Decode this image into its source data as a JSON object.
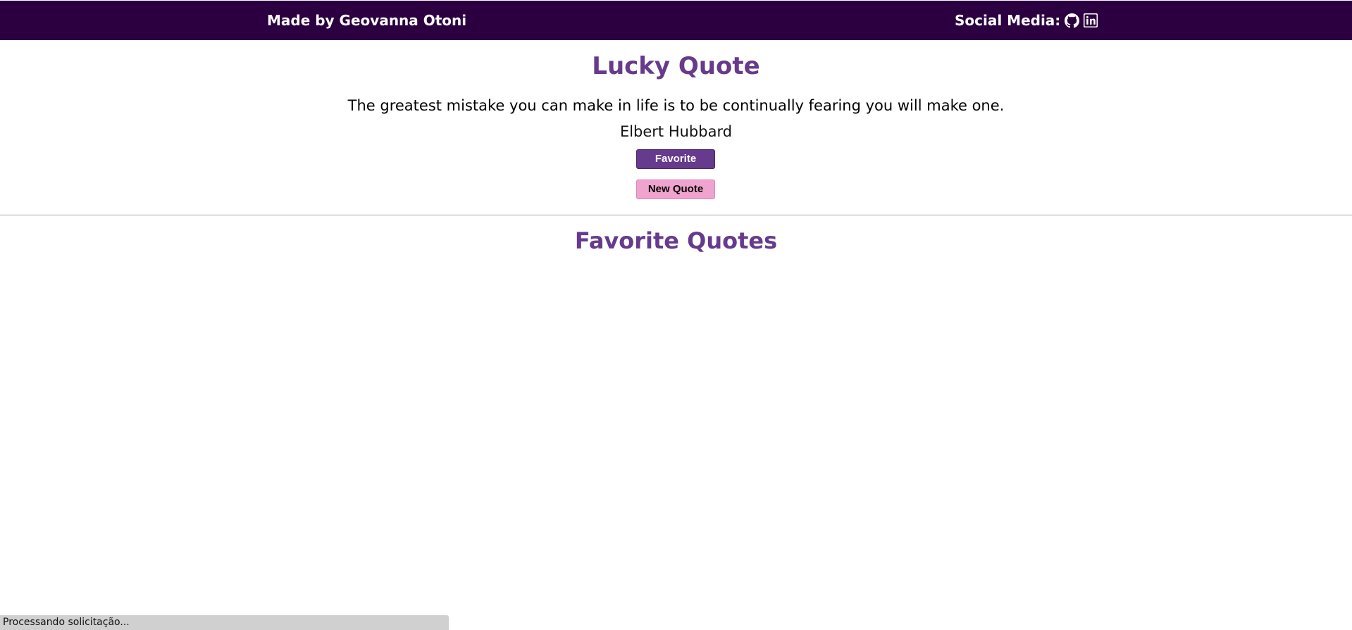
{
  "header": {
    "credit": "Made by Geovanna Otoni",
    "social_label": "Social Media:",
    "icons": [
      "github-icon",
      "linkedin-icon"
    ],
    "background_color": "#2c0040"
  },
  "lucky": {
    "title": "Lucky Quote",
    "quote": "The greatest mistake you can make in life is to be continually fearing you will make one.",
    "author": "Elbert Hubbard",
    "favorite_label": "Favorite",
    "new_quote_label": "New Quote",
    "accent_color": "#663a8c",
    "new_quote_color": "#f0a3cf"
  },
  "favorites": {
    "title": "Favorite Quotes",
    "items": []
  },
  "status": {
    "text": "Processando solicitação..."
  }
}
